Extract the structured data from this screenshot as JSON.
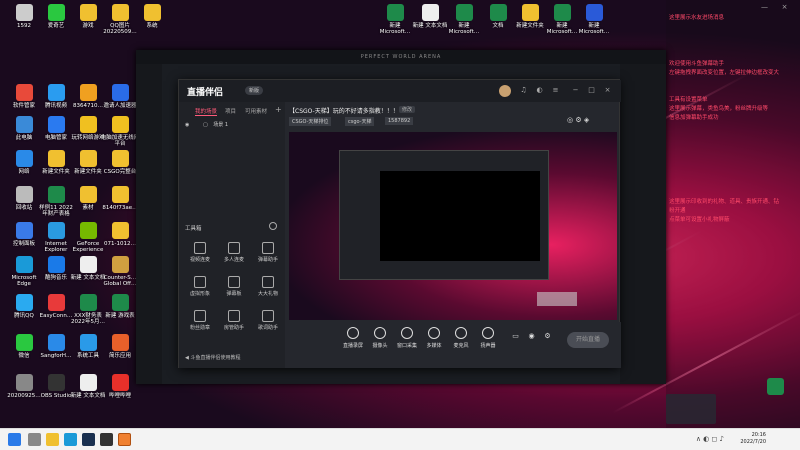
{
  "desktop_left": [
    {
      "label": "软件管家",
      "color": "#e84a3a"
    },
    {
      "label": "腾讯视频",
      "color": "#2a9cf0"
    },
    {
      "label": "8364710…",
      "color": "#f0a020"
    },
    {
      "label": "邀请人加速器",
      "color": "#2a6ce8"
    },
    {
      "label": "此电脑",
      "color": "#3a8ad8"
    },
    {
      "label": "电脑管家",
      "color": "#2a7af0"
    },
    {
      "label": "玩转网络游戏",
      "color": "#f0c020"
    },
    {
      "label": "电脑加速无线网平台",
      "color": "#f0c020"
    },
    {
      "label": "网络",
      "color": "#2a8ae8"
    },
    {
      "label": "新建文件夹",
      "color": "#f0c030"
    },
    {
      "label": "新建文件夹",
      "color": "#f0c030"
    },
    {
      "label": "CSGO完整台",
      "color": "#f0c030"
    },
    {
      "label": "回收站",
      "color": "#bbbbbb"
    },
    {
      "label": "样例11 2022 年财产表格",
      "color": "#1e8a4a"
    },
    {
      "label": "素材",
      "color": "#f0c030"
    },
    {
      "label": "8140f73ae…",
      "color": "#f0c030"
    },
    {
      "label": "控制面板",
      "color": "#3a7ae8"
    },
    {
      "label": "Internet Explorer",
      "color": "#2a9ae0"
    },
    {
      "label": "GeForce Experience",
      "color": "#76b900"
    },
    {
      "label": "071-1012…",
      "color": "#f0c030"
    },
    {
      "label": "Microsoft Edge",
      "color": "#1a9ad8"
    },
    {
      "label": "酷狗音乐",
      "color": "#1a7ae8"
    },
    {
      "label": "新建 文本文档",
      "color": "#eeeeee"
    },
    {
      "label": "Counter-S… Global Off…",
      "color": "#d0a040"
    },
    {
      "label": "腾讯QQ",
      "color": "#2aaaf0"
    },
    {
      "label": "EasyConn…",
      "color": "#e83a3a"
    },
    {
      "label": "XXX财务表 2022年5月…",
      "color": "#1e8a4a"
    },
    {
      "label": "新建 游戏表",
      "color": "#1e8a4a"
    },
    {
      "label": "微信",
      "color": "#2ac840"
    },
    {
      "label": "SangforH…",
      "color": "#2a8ae8"
    },
    {
      "label": "系统工具",
      "color": "#2a9ae8"
    },
    {
      "label": "简乐应用",
      "color": "#e8602a"
    },
    {
      "label": "20200925…",
      "color": "#888888"
    },
    {
      "label": "OBS Studio",
      "color": "#333333"
    },
    {
      "label": "新建 文本文档",
      "color": "#eeeeee"
    },
    {
      "label": "哔哩哔哩",
      "color": "#e8302a"
    }
  ],
  "desktop_top_left": [
    {
      "label": "1592",
      "color": "#cccccc"
    },
    {
      "label": "爱奇艺",
      "color": "#2ac840"
    },
    {
      "label": "游戏",
      "color": "#f0c030"
    },
    {
      "label": "QQ图片 20220509…",
      "color": "#f0c030"
    },
    {
      "label": "系统",
      "color": "#f0c030"
    }
  ],
  "desktop_top_right": [
    {
      "label": "新建 Microsoft…",
      "color": "#1e8a4a"
    },
    {
      "label": "新建 文本文档",
      "color": "#eeeeee"
    },
    {
      "label": "新建 Microsoft…",
      "color": "#1e8a4a"
    },
    {
      "label": "文档",
      "color": "#1e8a4a"
    },
    {
      "label": "新建文件夹",
      "color": "#f0c030"
    },
    {
      "label": "新建 Microsoft…",
      "color": "#1e8a4a"
    },
    {
      "label": "新建 Microsoft…",
      "color": "#2a5ad8"
    }
  ],
  "right_panel": {
    "lines1": [
      "这里展示水友进场消息"
    ],
    "lines2": [
      "欢迎使用斗鱼弹幕助手",
      "左键拖拽界面改变位置，左键拉伸边框改变大",
      "",
      "",
      "工具有设置菜单",
      "这里展示弹幕，类鱼鸟美，粉丝牌升级等",
      "信息加弹幕助手成功"
    ],
    "lines3": [
      "这里展示印收到的礼物、道具、贵族开通、钻",
      "粉开通",
      "点菜单可设置小礼物屏蔽"
    ]
  },
  "bg_window": {
    "title": "PERFECT WORLD ARENA"
  },
  "app": {
    "logo": "直播伴侣",
    "badge": "新版",
    "tabs": [
      "我的场景",
      "项目",
      "可用素材"
    ],
    "scene_item": "场景 1",
    "tools_title": "工具箱",
    "tools": [
      {
        "label": "视频连麦"
      },
      {
        "label": "多人连麦"
      },
      {
        "label": "弹幕助手"
      },
      {
        "label": "虚拟形象"
      },
      {
        "label": "弹幕板"
      },
      {
        "label": "大大礼物"
      },
      {
        "label": "粉丝勋章"
      },
      {
        "label": "房管助手"
      },
      {
        "label": "歌词助手"
      }
    ],
    "notice": "斗鱼直播伴侣使用教程",
    "stream_title": "【CSGO-天梯】玩的不好请多指教！！！",
    "edit_label": "修改",
    "category": "CSGO-天梯排位",
    "room": "csgo-天梯",
    "room_no": "1587892",
    "bottom_buttons": [
      {
        "label": "直播录屏"
      },
      {
        "label": "摄像头"
      },
      {
        "label": "窗口采集"
      },
      {
        "label": "多媒体"
      },
      {
        "label": "麦克风"
      },
      {
        "label": "扬声器"
      }
    ],
    "start_label": "开始直播"
  },
  "taskbar": {
    "time": "20:16",
    "date": "2022/7/20"
  }
}
